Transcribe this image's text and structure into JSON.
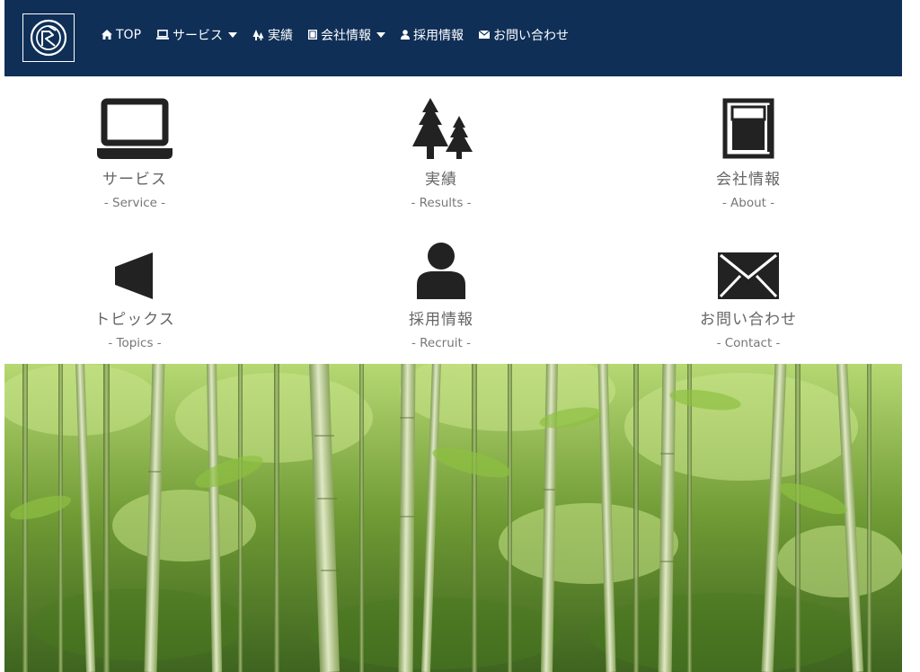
{
  "nav": {
    "top": "TOP",
    "service": "サービス",
    "results": "実績",
    "company": "会社情報",
    "recruit": "採用情報",
    "contact": "お問い合わせ"
  },
  "tiles": [
    {
      "jp": "サービス",
      "en": "- Service -",
      "icon": "laptop-icon"
    },
    {
      "jp": "実績",
      "en": "- Results -",
      "icon": "trees-icon"
    },
    {
      "jp": "会社情報",
      "en": "- About -",
      "icon": "document-icon"
    },
    {
      "jp": "トピックス",
      "en": "- Topics -",
      "icon": "megaphone-icon"
    },
    {
      "jp": "採用情報",
      "en": "- Recruit -",
      "icon": "person-icon"
    },
    {
      "jp": "お問い合わせ",
      "en": "- Contact -",
      "icon": "envelope-icon"
    }
  ],
  "colors": {
    "navbar": "#0f2f57",
    "icon": "#222222",
    "text": "#666666"
  }
}
